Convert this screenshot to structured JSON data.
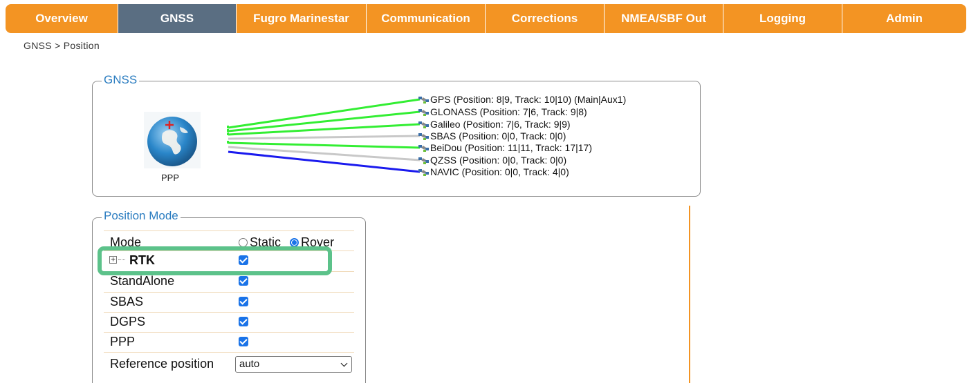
{
  "nav": {
    "tabs": [
      {
        "label": "Overview",
        "active": false
      },
      {
        "label": "GNSS",
        "active": true
      },
      {
        "label": "Fugro Marinestar",
        "active": false
      },
      {
        "label": "Communication",
        "active": false
      },
      {
        "label": "Corrections",
        "active": false
      },
      {
        "label": "NMEA/SBF Out",
        "active": false
      },
      {
        "label": "Logging",
        "active": false
      },
      {
        "label": "Admin",
        "active": false
      }
    ]
  },
  "breadcrumb": "GNSS > Position",
  "gnss_panel": {
    "legend": "GNSS",
    "mode_icon": "globe-icon",
    "mode_label": "PPP",
    "satellite_icon": "satellite-icon",
    "systems": [
      {
        "text": "GPS (Position: 8|9, Track: 10|10) (Main|Aux1)",
        "line_color": "#33ee33"
      },
      {
        "text": "GLONASS (Position: 7|6, Track: 9|8)",
        "line_color": "#33ee33"
      },
      {
        "text": "Galileo (Position: 7|6, Track: 9|9)",
        "line_color": "#33ee33"
      },
      {
        "text": "SBAS (Position: 0|0, Track: 0|0)",
        "line_color": "#c8c8c8"
      },
      {
        "text": "BeiDou (Position: 11|11, Track: 17|17)",
        "line_color": "#33ee33"
      },
      {
        "text": "QZSS (Position: 0|0, Track: 0|0)",
        "line_color": "#c8c8c8"
      },
      {
        "text": "NAVIC (Position: 0|0, Track: 4|0)",
        "line_color": "#1a1aee"
      }
    ]
  },
  "position_mode": {
    "legend": "Position Mode",
    "mode_label": "Mode",
    "mode_options": [
      {
        "label": "Static",
        "checked": false
      },
      {
        "label": "Rover",
        "checked": true
      }
    ],
    "rows": [
      {
        "label": "RTK",
        "checked": true,
        "expandable": true
      },
      {
        "label": "StandAlone",
        "checked": true
      },
      {
        "label": "SBAS",
        "checked": true
      },
      {
        "label": "DGPS",
        "checked": true
      },
      {
        "label": "PPP",
        "checked": true
      }
    ],
    "reference_position_label": "Reference position",
    "reference_position_value": "auto"
  },
  "colors": {
    "accent": "#f39423",
    "active_tab": "#5a6e82",
    "legend_text": "#2a7cc0",
    "highlight": "#5cc28a",
    "checkbox": "#1a73e8"
  }
}
